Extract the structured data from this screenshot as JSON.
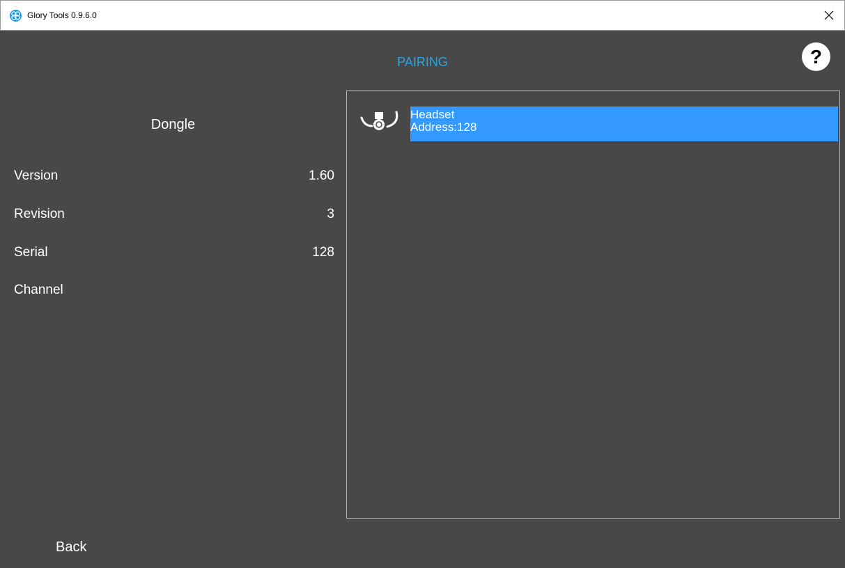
{
  "window": {
    "title": "Glory Tools 0.9.6.0",
    "icon": "glory-logo-icon",
    "close_icon": "close-icon"
  },
  "header": {
    "title": "PAIRING",
    "help_label": "?"
  },
  "dongle": {
    "title": "Dongle",
    "rows": [
      {
        "label": "Version",
        "value": "1.60"
      },
      {
        "label": "Revision",
        "value": "3"
      },
      {
        "label": "Serial",
        "value": "128"
      },
      {
        "label": "Channel",
        "value": ""
      }
    ]
  },
  "devices": [
    {
      "name": "Headset",
      "address": "Address:128",
      "icon": "headset-icon",
      "selected": true
    }
  ],
  "footer": {
    "back_label": "Back"
  },
  "colors": {
    "background": "#484848",
    "accent": "#2fa3de",
    "selection": "#3399ff"
  }
}
